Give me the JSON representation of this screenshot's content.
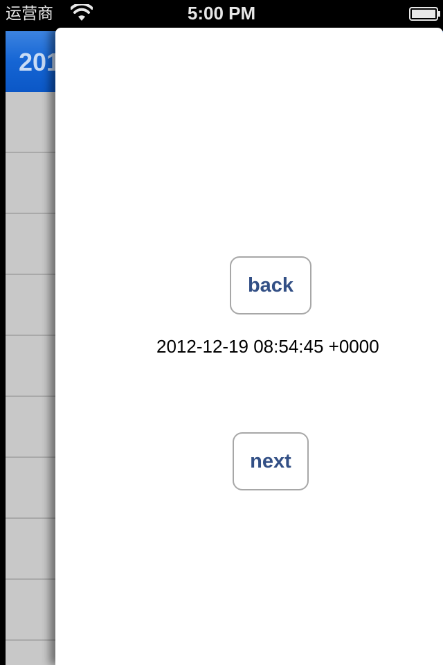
{
  "status_bar": {
    "carrier": "运营商",
    "time": "5:00 PM",
    "wifi_icon": "wifi-icon",
    "battery_icon": "battery-full-icon"
  },
  "background_view": {
    "header_text": "201"
  },
  "panel": {
    "back_label": "back",
    "date_text": "2012-12-19 08:54:45 +0000",
    "next_label": "next"
  },
  "colors": {
    "button_text": "#324f85",
    "header_blue": "#1565d4"
  }
}
